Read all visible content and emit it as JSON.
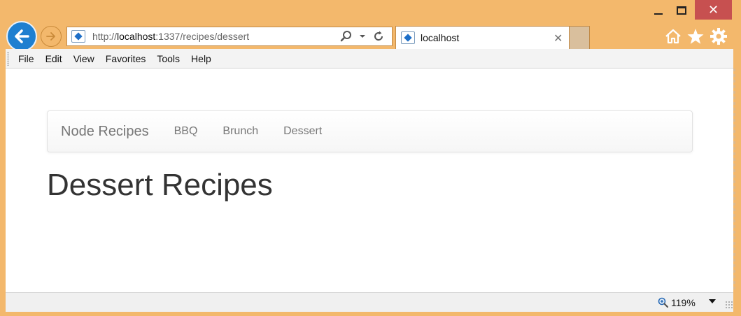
{
  "window": {
    "controls": {
      "minimize": "minimize",
      "maximize": "maximize",
      "close": "✕"
    },
    "colors": {
      "frame": "#f3b86c",
      "close": "#c75050",
      "back": "#1e7fd0"
    }
  },
  "toolbar": {
    "address": {
      "prefix": "http://",
      "host": "localhost",
      "rest": ":1337/recipes/dessert"
    },
    "tab": {
      "title": "localhost",
      "close": "✕"
    },
    "icons": [
      "back-icon",
      "forward-icon",
      "search-icon",
      "dropdown-icon",
      "refresh-icon",
      "home-icon",
      "favorites-star-icon",
      "settings-gear-icon"
    ]
  },
  "menubar": {
    "items": [
      {
        "label": "File"
      },
      {
        "label": "Edit"
      },
      {
        "label": "View"
      },
      {
        "label": "Favorites"
      },
      {
        "label": "Tools"
      },
      {
        "label": "Help"
      }
    ]
  },
  "page": {
    "navbar": {
      "brand": "Node Recipes",
      "links": [
        {
          "label": "BBQ"
        },
        {
          "label": "Brunch"
        },
        {
          "label": "Dessert"
        }
      ]
    },
    "title": "Dessert Recipes"
  },
  "statusbar": {
    "zoom": "119%"
  }
}
